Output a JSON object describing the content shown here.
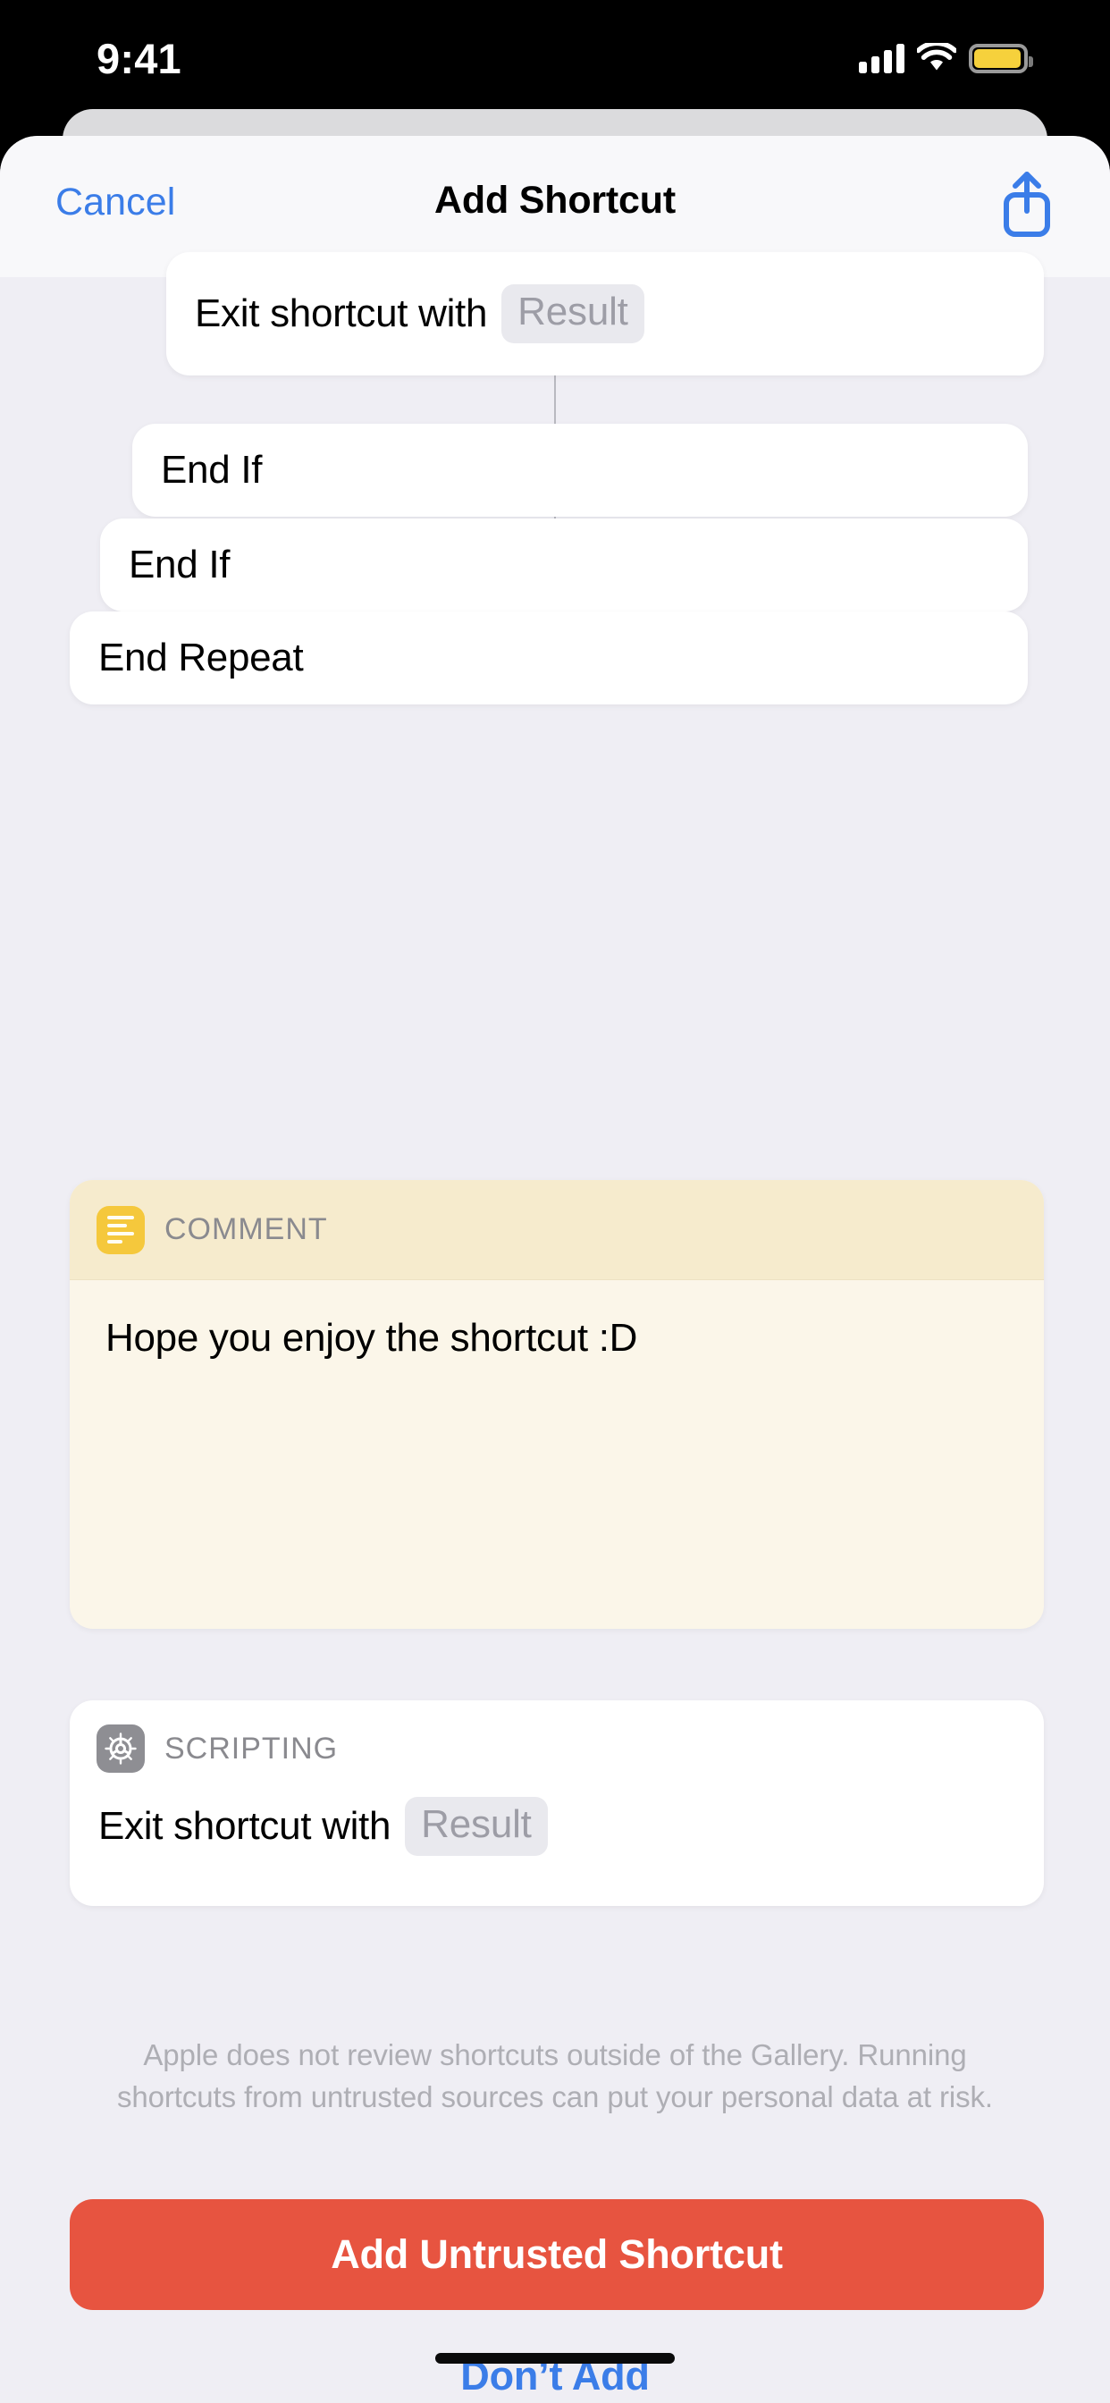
{
  "status_bar": {
    "time": "9:41",
    "cellular_icon": "cellular-bars-icon",
    "wifi_icon": "wifi-icon",
    "battery_icon": "battery-icon",
    "battery_color": "#F6D13C"
  },
  "nav": {
    "cancel_label": "Cancel",
    "title": "Add Shortcut",
    "share_icon": "share-icon",
    "accent_color": "#3B7DE8"
  },
  "actions": [
    {
      "text": "Exit shortcut with",
      "token": "Result"
    },
    {
      "text": "End If",
      "token": ""
    },
    {
      "text": "End If",
      "token": ""
    },
    {
      "text": "End Repeat",
      "token": ""
    }
  ],
  "comment": {
    "header_label": "COMMENT",
    "header_icon": "comment-note-icon",
    "icon_color": "#F5C83C",
    "header_bg": "#F6EBCD",
    "body_bg": "#FBF6E9",
    "text": "Hope you enjoy the shortcut :D"
  },
  "scripting": {
    "header_label": "SCRIPTING",
    "header_icon": "gear-icon",
    "icon_color": "#8E8E93",
    "action_text": "Exit shortcut with",
    "token": "Result"
  },
  "disclaimer": "Apple does not review shortcuts outside of the Gallery. Running shortcuts from untrusted sources can put your personal data at risk.",
  "buttons": {
    "add_label": "Add Untrusted Shortcut",
    "add_color": "#E75440",
    "dont_add_label": "Don’t Add",
    "dont_add_color": "#3B7DE8"
  }
}
